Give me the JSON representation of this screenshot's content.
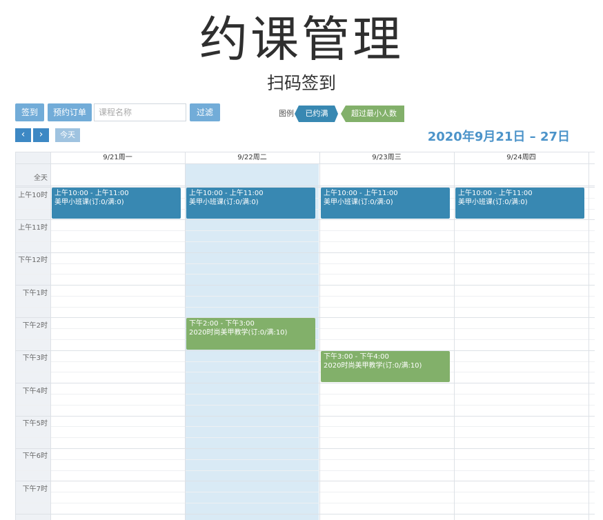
{
  "page": {
    "title": "约课管理",
    "subtitle": "扫码签到"
  },
  "toolbar": {
    "checkin_label": "签到",
    "booking_orders_label": "预约订单",
    "search_placeholder": "课程名称",
    "filter_label": "过滤",
    "legend_label": "图例",
    "legend_items": [
      {
        "label": "已约满",
        "color": "#3888b2"
      },
      {
        "label": "超过最小人数",
        "color": "#82b06a"
      }
    ]
  },
  "nav": {
    "prev_symbol": "‹",
    "next_symbol": "›",
    "today_label": "今天",
    "date_range": "2020年9月21日 – 27日"
  },
  "calendar": {
    "days": [
      "9/21周一",
      "9/22周二",
      "9/23周三",
      "9/24周四"
    ],
    "highlighted_day": "9/22周二",
    "all_day_label": "全天",
    "time_slots": [
      "上午10时",
      "上午11时",
      "下午12时",
      "下午1时",
      "下午2时",
      "下午3时",
      "下午4时",
      "下午5时",
      "下午6时",
      "下午7时"
    ],
    "events": [
      {
        "time": "上午10:00 - 上午11:00",
        "title": "美甲小班课(订:0/满:0)"
      },
      {
        "time": "上午10:00 - 上午11:00",
        "title": "美甲小班课(订:0/满:0)"
      },
      {
        "time": "上午10:00 - 上午11:00",
        "title": "美甲小班课(订:0/满:0)"
      },
      {
        "time": "上午10:00 - 上午11:00",
        "title": "美甲小班课(订:0/满:0)"
      },
      {
        "time": "下午2:00 - 下午3:00",
        "title": "2020时尚美甲教学(订:0/满:10)"
      },
      {
        "time": "下午3:00 - 下午4:00",
        "title": "2020时尚美甲教学(订:0/满:10)"
      }
    ],
    "colors": {
      "full": "#3888b2",
      "over_minimum": "#82b06a",
      "highlight": "#d9eaf5",
      "gutter": "#eef1f5"
    }
  }
}
